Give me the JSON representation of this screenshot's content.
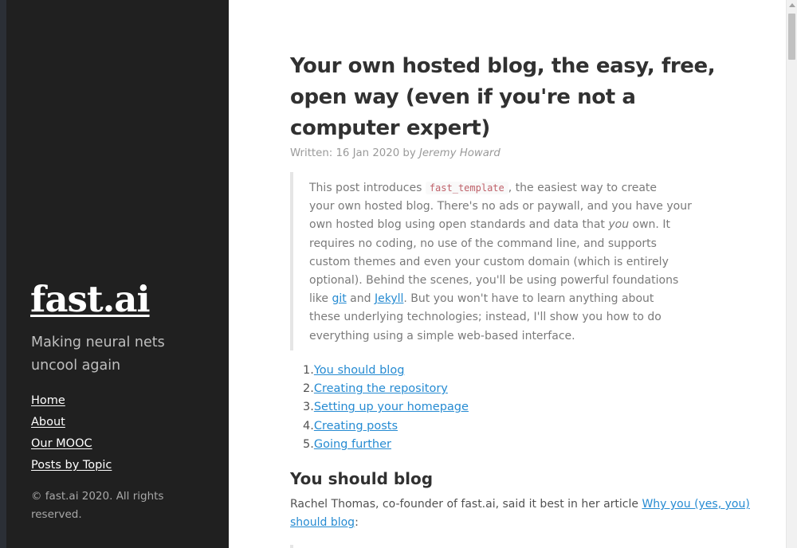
{
  "sidebar": {
    "brand": "fast.ai",
    "tagline": "Making neural nets uncool again",
    "nav": [
      {
        "label": "Home"
      },
      {
        "label": "About"
      },
      {
        "label": "Our MOOC"
      },
      {
        "label": "Posts by Topic"
      }
    ],
    "copyright": "© fast.ai 2020. All rights reserved."
  },
  "post": {
    "title": "Your own hosted blog, the easy, free, open way (even if you're not a computer expert)",
    "meta": {
      "written_label": "Written: 16 Jan 2020 by ",
      "author": "Jeremy Howard"
    },
    "intro": {
      "l1_pre": "This post introduces ",
      "code": "fast_template",
      "l1_post": ", the easiest way to create",
      "l2": "your own hosted blog. There's no ads or paywall, and you have your",
      "l3_pre": "own hosted blog using open standards and data that ",
      "l3_em": "you",
      "l3_post": " own. It",
      "l4": "requires no coding, no use of the command line, and supports",
      "l5": "custom themes and even your custom domain (which is entirely",
      "l6": "optional). Behind the scenes, you'll be using powerful foundations",
      "l7_pre": "like ",
      "link_git": "git",
      "l7_mid": " and ",
      "link_jekyll": "Jekyll",
      "l7_post": ". But you won't have to learn anything about",
      "l8": "these underlying technologies; instead, I'll show you how to do",
      "l9": "everything using a simple web-based interface."
    },
    "toc": [
      {
        "num": "1.",
        "label": "You should blog"
      },
      {
        "num": "2.",
        "label": "Creating the repository"
      },
      {
        "num": "3.",
        "label": "Setting up your homepage"
      },
      {
        "num": "4.",
        "label": "Creating posts"
      },
      {
        "num": "5.",
        "label": "Going further"
      }
    ],
    "section1": {
      "heading": "You should blog",
      "para_pre": "Rachel Thomas, co-founder of fast.ai, said it best in her article ",
      "link_a": "Why you (yes, you)",
      "link_b": "should blog",
      "para_post": ":"
    }
  },
  "colors": {
    "sidebar_bg": "#202020",
    "link": "#268bd2",
    "code_text": "#bf616a"
  }
}
